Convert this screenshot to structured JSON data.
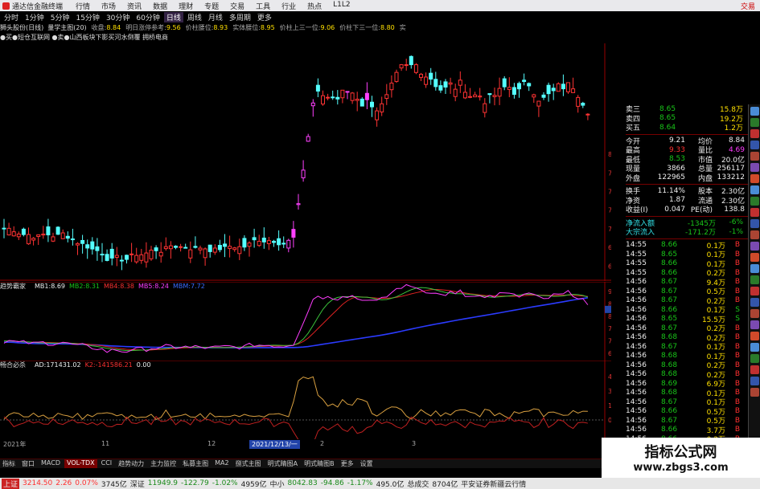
{
  "app": {
    "title": "通达信金融终端",
    "menu": [
      "行情",
      "市场",
      "资讯",
      "数据",
      "理财",
      "专题",
      "交易",
      "工具",
      "行业",
      "热点",
      "L1L2"
    ],
    "breaking": "交易"
  },
  "periods": [
    "分时",
    "1分钟",
    "5分钟",
    "15分钟",
    "30分钟",
    "60分钟",
    "日线",
    "周线",
    "月线",
    "多周期",
    "更多"
  ],
  "active_period": "日线",
  "info": {
    "stock": "狮头股份(日线)",
    "indicator": "量学主图(20)",
    "items": [
      {
        "k": "明日涨停参考:",
        "v": "9.56"
      },
      {
        "k": "价柱腰位:",
        "v": "8.93"
      },
      {
        "k": "实体腰位:",
        "v": "8.95"
      },
      {
        "k": "价柱上三一位:",
        "v": "9.06"
      },
      {
        "k": "价柱下三一位:",
        "v": "8.80"
      },
      {
        "k": "实",
        "v": ""
      }
    ],
    "close_label": "收盘:",
    "close": "8.84"
  },
  "signals": "●买●短仓互联网 ●卖●山西板块下影买河水倒覆 拥桥电商",
  "main_axis": [
    "8.00",
    "7.75",
    "7.50",
    "7.25",
    "7.00",
    "6.75",
    "6.50"
  ],
  "ind1": {
    "name": "趋势霸家",
    "items": [
      {
        "k": "MB1:",
        "v": "8.69",
        "c": "white"
      },
      {
        "k": "MB2:",
        "v": "8.31",
        "c": "green"
      },
      {
        "k": "MB4:",
        "v": "8.38",
        "c": "red"
      },
      {
        "k": "MB5:",
        "v": "8.24",
        "c": "mag"
      },
      {
        "k": "MBM:",
        "v": "7.72",
        "c": "blu"
      }
    ],
    "axis": [
      "9.00",
      "8.50",
      "8.00",
      "7.50",
      "7.00",
      "6.50"
    ],
    "tag": "8.26"
  },
  "ind2": {
    "name": "畅合必杀",
    "items": [
      {
        "k": "AD:",
        "v": "171431.02",
        "c": "white"
      },
      {
        "k": "K2:",
        "v": "-141586.21",
        "c": "red"
      },
      {
        "k": "",
        "v": "0.00",
        "c": "white"
      }
    ],
    "axis": [
      "45000",
      "30000",
      "15000",
      "0"
    ]
  },
  "quote": {
    "asks": [
      {
        "l": "卖三",
        "p": "8.65",
        "v": "15.8万"
      },
      {
        "l": "卖四",
        "p": "8.65",
        "v": "19.2万"
      },
      {
        "l": "买五",
        "p": "8.64",
        "v": "1.2万"
      }
    ],
    "stats": [
      {
        "a": "今开",
        "b": "9.21",
        "c": "均价",
        "d": "8.84"
      },
      {
        "a": "最高",
        "b": "9.33",
        "c": "量比",
        "d": "4.69"
      },
      {
        "a": "最低",
        "b": "8.53",
        "c": "市值",
        "d": "20.0亿"
      },
      {
        "a": "现量",
        "b": "3866",
        "c": "总量",
        "d": "256117"
      },
      {
        "a": "外盘",
        "b": "122965",
        "c": "内盘",
        "d": "133212"
      }
    ],
    "fund": [
      {
        "a": "换手",
        "b": "11.14%",
        "c": "股本",
        "d": "2.30亿"
      },
      {
        "a": "净资",
        "b": "1.87",
        "c": "流通",
        "d": "2.30亿"
      },
      {
        "a": "收益(I)",
        "b": "0.047",
        "c": "PE(动)",
        "d": "138.8"
      }
    ],
    "flow": [
      {
        "l": "净流入额",
        "v": "-1345万",
        "p": "-6%"
      },
      {
        "l": "大宗流入",
        "v": "-171.2万",
        "p": "-1%"
      }
    ],
    "ticks": [
      [
        "14:55",
        "8.66",
        "0.1万",
        "B"
      ],
      [
        "14:55",
        "8.65",
        "0.1万",
        "B"
      ],
      [
        "14:55",
        "8.66",
        "0.1万",
        "B"
      ],
      [
        "14:55",
        "8.66",
        "0.2万",
        "B"
      ],
      [
        "14:56",
        "8.67",
        "9.4万",
        "B"
      ],
      [
        "14:56",
        "8.67",
        "0.5万",
        "B"
      ],
      [
        "14:56",
        "8.67",
        "0.2万",
        "B"
      ],
      [
        "14:56",
        "8.66",
        "0.1万",
        "S"
      ],
      [
        "14:56",
        "8.65",
        "15.5万",
        "S"
      ],
      [
        "14:56",
        "8.67",
        "0.2万",
        "B"
      ],
      [
        "14:56",
        "8.68",
        "0.2万",
        "B"
      ],
      [
        "14:56",
        "8.67",
        "0.1万",
        "B"
      ],
      [
        "14:56",
        "8.68",
        "0.1万",
        "B"
      ],
      [
        "14:56",
        "8.68",
        "0.2万",
        "B"
      ],
      [
        "14:56",
        "8.68",
        "0.2万",
        "B"
      ],
      [
        "14:56",
        "8.69",
        "6.9万",
        "B"
      ],
      [
        "14:56",
        "8.68",
        "0.1万",
        "B"
      ],
      [
        "14:56",
        "8.67",
        "0.1万",
        "B"
      ],
      [
        "14:56",
        "8.66",
        "0.5万",
        "B"
      ],
      [
        "14:56",
        "8.67",
        "0.5万",
        "B"
      ],
      [
        "14:56",
        "8.66",
        "3.7万",
        "B"
      ],
      [
        "14:56",
        "8.66",
        "0.2万",
        "B"
      ],
      [
        "14:56",
        "8.66",
        "1.1万",
        "B"
      ]
    ]
  },
  "dates": [
    "2021年",
    "11",
    "12",
    "2021/12/13/一",
    "2",
    "3"
  ],
  "tabs": [
    "指标",
    "窗口",
    "MACD",
    "VOL-TDX",
    "CCI",
    "趋势动力",
    "主力监控",
    "私募主图",
    "MA2",
    "捌式主图",
    "明式睛图A",
    "明式睛图B",
    "更多",
    "设置"
  ],
  "active_tab": "VOL-TDX",
  "status": {
    "sh_label": "上证",
    "sh": "3214.50",
    "sh_chg": "2.26",
    "sh_pct": "0.07%",
    "sh_amt": "3745亿",
    "sz_label": "深证",
    "sz": "11949.9",
    "sz_chg": "-122.79",
    "sz_pct": "-1.02%",
    "sz_amt": "4959亿",
    "zx_label": "中小",
    "zx": "8042.83",
    "zx_chg": "-94.86",
    "zx_pct": "-1.17%",
    "zx_amt": "495.0亿",
    "tot_label": "总成交",
    "tot": "8704亿",
    "msg": "平安证券新疆云行情"
  },
  "watermark": {
    "line1": "指标公式网",
    "line2": "www.zbgs3.com"
  }
}
